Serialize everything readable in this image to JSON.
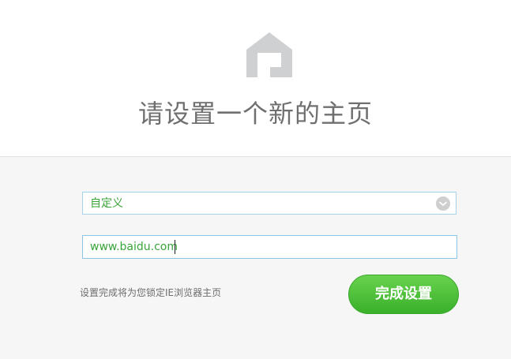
{
  "header": {
    "title": "请设置一个新的主页",
    "logo_icon": "home-icon",
    "logo_color": "#cfd0d2"
  },
  "form": {
    "select": {
      "value": "自定义",
      "arrow_icon": "chevron-down-icon"
    },
    "url_input": {
      "value": "www.baidu.com"
    },
    "hint": "设置完成将为您锁定IE浏览器主页",
    "submit_label": "完成设置"
  },
  "colors": {
    "accent_green": "#3ab02b",
    "field_border": "#8cc5e6",
    "value_text": "#3aa43a"
  }
}
